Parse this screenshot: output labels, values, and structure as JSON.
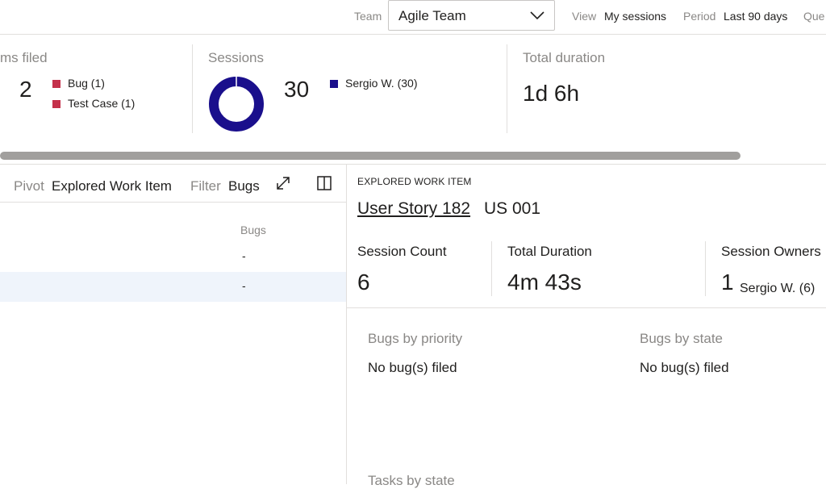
{
  "filters": {
    "team_label": "Team",
    "team_value": "Agile Team",
    "view_label": "View",
    "view_value": "My sessions",
    "period_label": "Period",
    "period_value": "Last 90 days",
    "query_label": "Que"
  },
  "summary": {
    "items_filed": {
      "title": "ms filed",
      "count": "2",
      "legend": [
        {
          "label": "Bug (1)",
          "color": "#c4314b"
        },
        {
          "label": "Test Case (1)",
          "color": "#c4314b"
        }
      ]
    },
    "sessions": {
      "title": "Sessions",
      "count": "30",
      "donut_color": "#1a0f8c",
      "legend": [
        {
          "label": "Sergio W. (30)",
          "color": "#1a0f8c"
        }
      ]
    },
    "total_duration": {
      "title": "Total duration",
      "value": "1d 6h"
    }
  },
  "left_pane": {
    "pivot_label": "Pivot",
    "pivot_value": "Explored Work Item",
    "filter_label": "Filter",
    "filter_value": "Bugs",
    "column_header": "Bugs",
    "rows": [
      {
        "bugs": "-"
      },
      {
        "bugs": "-"
      }
    ]
  },
  "detail": {
    "eyebrow": "EXPLORED WORK ITEM",
    "work_item_link": "User Story 182",
    "work_item_id": "US 001",
    "stats": {
      "session_count_label": "Session Count",
      "session_count_value": "6",
      "total_duration_label": "Total Duration",
      "total_duration_value": "4m 43s",
      "session_owners_label": "Session Owners",
      "session_owners_count": "1",
      "session_owners_name": "Sergio W. (6)"
    },
    "bugs_by_priority_title": "Bugs by priority",
    "bugs_by_priority_text": "No bug(s) filed",
    "bugs_by_state_title": "Bugs by state",
    "bugs_by_state_text": "No bug(s) filed",
    "tasks_by_state_title": "Tasks by state"
  }
}
